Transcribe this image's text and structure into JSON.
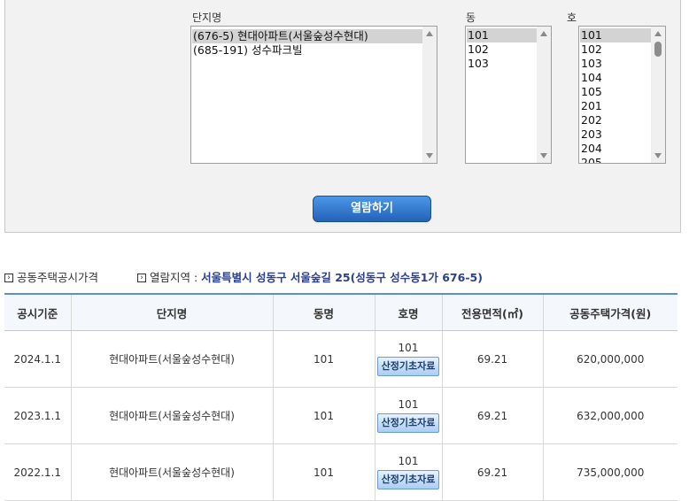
{
  "search": {
    "complex_label": "단지명",
    "dong_label": "동",
    "ho_label": "호",
    "complex_options": [
      "(676-5) 현대아파트(서울숲성수현대)",
      "(685-191) 성수파크빌"
    ],
    "complex_selected": "(676-5) 현대아파트(서울숲성수현대)",
    "dong_options": [
      "101",
      "102",
      "103"
    ],
    "dong_selected": "101",
    "ho_options": [
      "101",
      "102",
      "103",
      "104",
      "105",
      "201",
      "202",
      "203",
      "204",
      "205"
    ],
    "ho_selected": "101",
    "view_button": "열람하기"
  },
  "info": {
    "section_title": "공동주택공시가격",
    "region_label": "열람지역 :",
    "region_value": "서울특별시 성동구 서울숲길 25(성동구 성수동1가 676-5)"
  },
  "table": {
    "headers": [
      "공시기준",
      "단지명",
      "동명",
      "호명",
      "전용면적(㎡)",
      "공동주택가격(원)"
    ],
    "basis_button": "산정기초자료",
    "rows": [
      {
        "date": "2024.1.1",
        "complex": "현대아파트(서울숲성수현대)",
        "dong": "101",
        "ho": "101",
        "area": "69.21",
        "price": "620,000,000"
      },
      {
        "date": "2023.1.1",
        "complex": "현대아파트(서울숲성수현대)",
        "dong": "101",
        "ho": "101",
        "area": "69.21",
        "price": "632,000,000"
      },
      {
        "date": "2022.1.1",
        "complex": "현대아파트(서울숲성수현대)",
        "dong": "101",
        "ho": "101",
        "area": "69.21",
        "price": "735,000,000"
      }
    ]
  }
}
